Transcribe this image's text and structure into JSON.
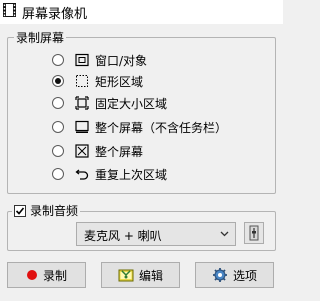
{
  "window": {
    "title": "屏幕录像机"
  },
  "capture_group": {
    "legend": "录制屏幕",
    "options": [
      {
        "label": "窗口/对象",
        "icon": "window-object-icon",
        "selected": false
      },
      {
        "label": "矩形区域",
        "icon": "rectangle-region-icon",
        "selected": true
      },
      {
        "label": "固定大小区域",
        "icon": "fixed-size-region-icon",
        "selected": false
      },
      {
        "label": "整个屏幕（不含任务栏）",
        "icon": "screen-no-taskbar-icon",
        "selected": false
      },
      {
        "label": "整个屏幕",
        "icon": "fullscreen-icon",
        "selected": false
      },
      {
        "label": "重复上次区域",
        "icon": "repeat-last-region-icon",
        "selected": false
      }
    ]
  },
  "audio_group": {
    "label": "录制音频",
    "checked": true,
    "source_value": "麦克风 + 喇叭"
  },
  "buttons": {
    "record": "录制",
    "edit": "编辑",
    "options": "选项"
  },
  "colors": {
    "record_dot": "#e01010",
    "background": "#f0f0f0",
    "button_face": "#e1e1e1"
  }
}
